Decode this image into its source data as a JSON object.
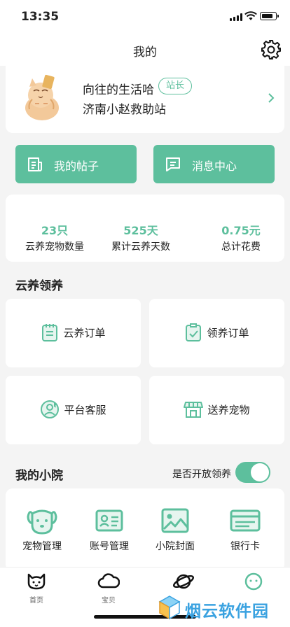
{
  "status_bar": {
    "time": "13:35"
  },
  "nav": {
    "title": "我的"
  },
  "profile": {
    "name": "向往的生活哈",
    "badge": "站长",
    "org": "济南小赵救助站"
  },
  "actions": {
    "posts": "我的帖子",
    "messages": "消息中心"
  },
  "stats": [
    {
      "value": "23只",
      "label": "云养宠物数量"
    },
    {
      "value": "525天",
      "label": "累计云养天数"
    },
    {
      "value": "0.75元",
      "label": "总计花费"
    }
  ],
  "adoption_section": {
    "title": "云养领养",
    "items": [
      "云养订单",
      "领养订单",
      "平台客服",
      "送养宠物"
    ]
  },
  "yard_section": {
    "title": "我的小院",
    "toggle_label": "是否开放领养",
    "toggle_on": true,
    "items": [
      "宠物管理",
      "账号管理",
      "小院封面",
      "银行卡"
    ]
  },
  "tabbar": {
    "items": [
      "首页",
      "宝贝",
      "",
      ""
    ]
  },
  "watermark": {
    "text": "烟云软件园"
  },
  "colors": {
    "accent": "#5dbf9d",
    "background": "#f4f4f4"
  }
}
